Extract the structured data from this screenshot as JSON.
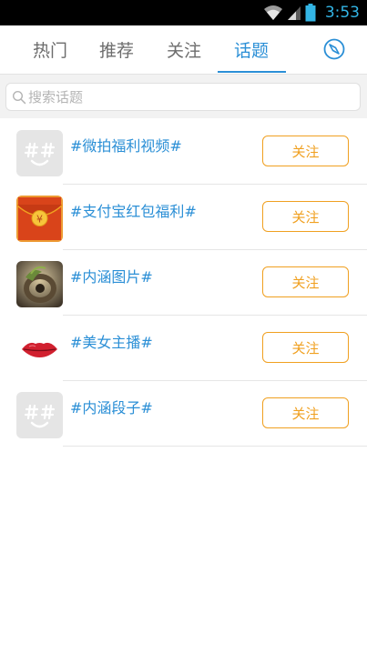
{
  "status_bar": {
    "time": "3:53"
  },
  "tabs": [
    {
      "label": "热门"
    },
    {
      "label": "推荐"
    },
    {
      "label": "关注"
    },
    {
      "label": "话题",
      "active": true
    }
  ],
  "search": {
    "placeholder": "搜索话题"
  },
  "topics": [
    {
      "name": "#微拍福利视频#",
      "avatar": "placeholder-hash-icon",
      "follow_label": "关注"
    },
    {
      "name": "#支付宝红包福利#",
      "avatar": "red-envelope-icon",
      "follow_label": "关注"
    },
    {
      "name": "#内涵图片#",
      "avatar": "artwork-thumbnail",
      "follow_label": "关注"
    },
    {
      "name": "#美女主播#",
      "avatar": "lips-icon",
      "follow_label": "关注"
    },
    {
      "name": "#内涵段子#",
      "avatar": "placeholder-hash-icon",
      "follow_label": "关注"
    }
  ],
  "colors": {
    "accent": "#2b8fd6",
    "follow": "#f0a020",
    "status_time": "#33b5e5"
  }
}
